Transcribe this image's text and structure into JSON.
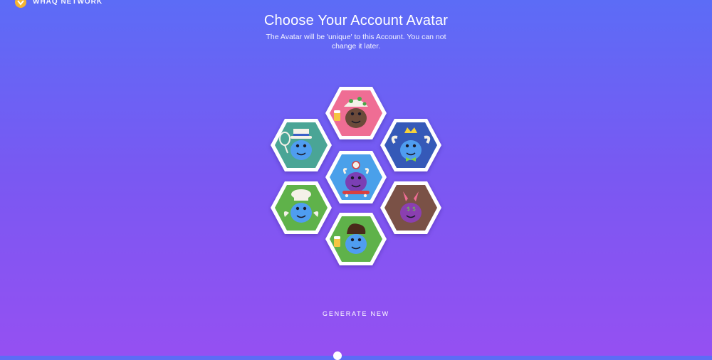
{
  "app": {
    "logo_text": "WHAQ NETWORK"
  },
  "header": {
    "title": "Choose Your Account Avatar",
    "subtitle": "The Avatar will be 'unique' to this Account. You can not change it later."
  },
  "avatars": [
    {
      "id": "top",
      "bg": "#ef6d94",
      "creature": "#6b4a3a",
      "hat": "mushroom-cap",
      "accessory": "beer-mug",
      "icon": "beaver-mushroom-avatar"
    },
    {
      "id": "upper-left",
      "bg": "#4aa596",
      "creature": "#4f9df0",
      "hat": "pilgrim-hat",
      "accessory": "tennis-racket",
      "icon": "blue-monster-pilgrim-avatar"
    },
    {
      "id": "upper-right",
      "bg": "#3559b8",
      "creature": "#4f9df0",
      "hat": "crown-horns",
      "accessory": "bow-tie",
      "icon": "blue-monster-crown-avatar"
    },
    {
      "id": "center",
      "bg": "#4aa0ea",
      "creature": "#7b3fb4",
      "hat": "doctor-mirror",
      "accessory": "skateboard",
      "icon": "purple-monster-skateboard-avatar"
    },
    {
      "id": "lower-left",
      "bg": "#5fb24a",
      "creature": "#4f9df0",
      "hat": "chef-hat",
      "accessory": "wings",
      "icon": "blue-monster-chef-avatar"
    },
    {
      "id": "lower-right",
      "bg": "#7a5146",
      "creature": "#8a3fb0",
      "hat": "bunny-ears",
      "accessory": "dollar-eyes",
      "icon": "purple-octopus-dollar-avatar"
    },
    {
      "id": "bottom",
      "bg": "#5fb24a",
      "creature": "#4f9df0",
      "hat": "pompadour",
      "accessory": "beer-mug",
      "icon": "blue-monster-pompadour-avatar"
    }
  ],
  "actions": {
    "generate_label": "GENERATE NEW"
  },
  "colors": {
    "bg_top": "#5c6cf6",
    "bg_bottom": "#9550f2",
    "hex_border": "#ffffff"
  }
}
